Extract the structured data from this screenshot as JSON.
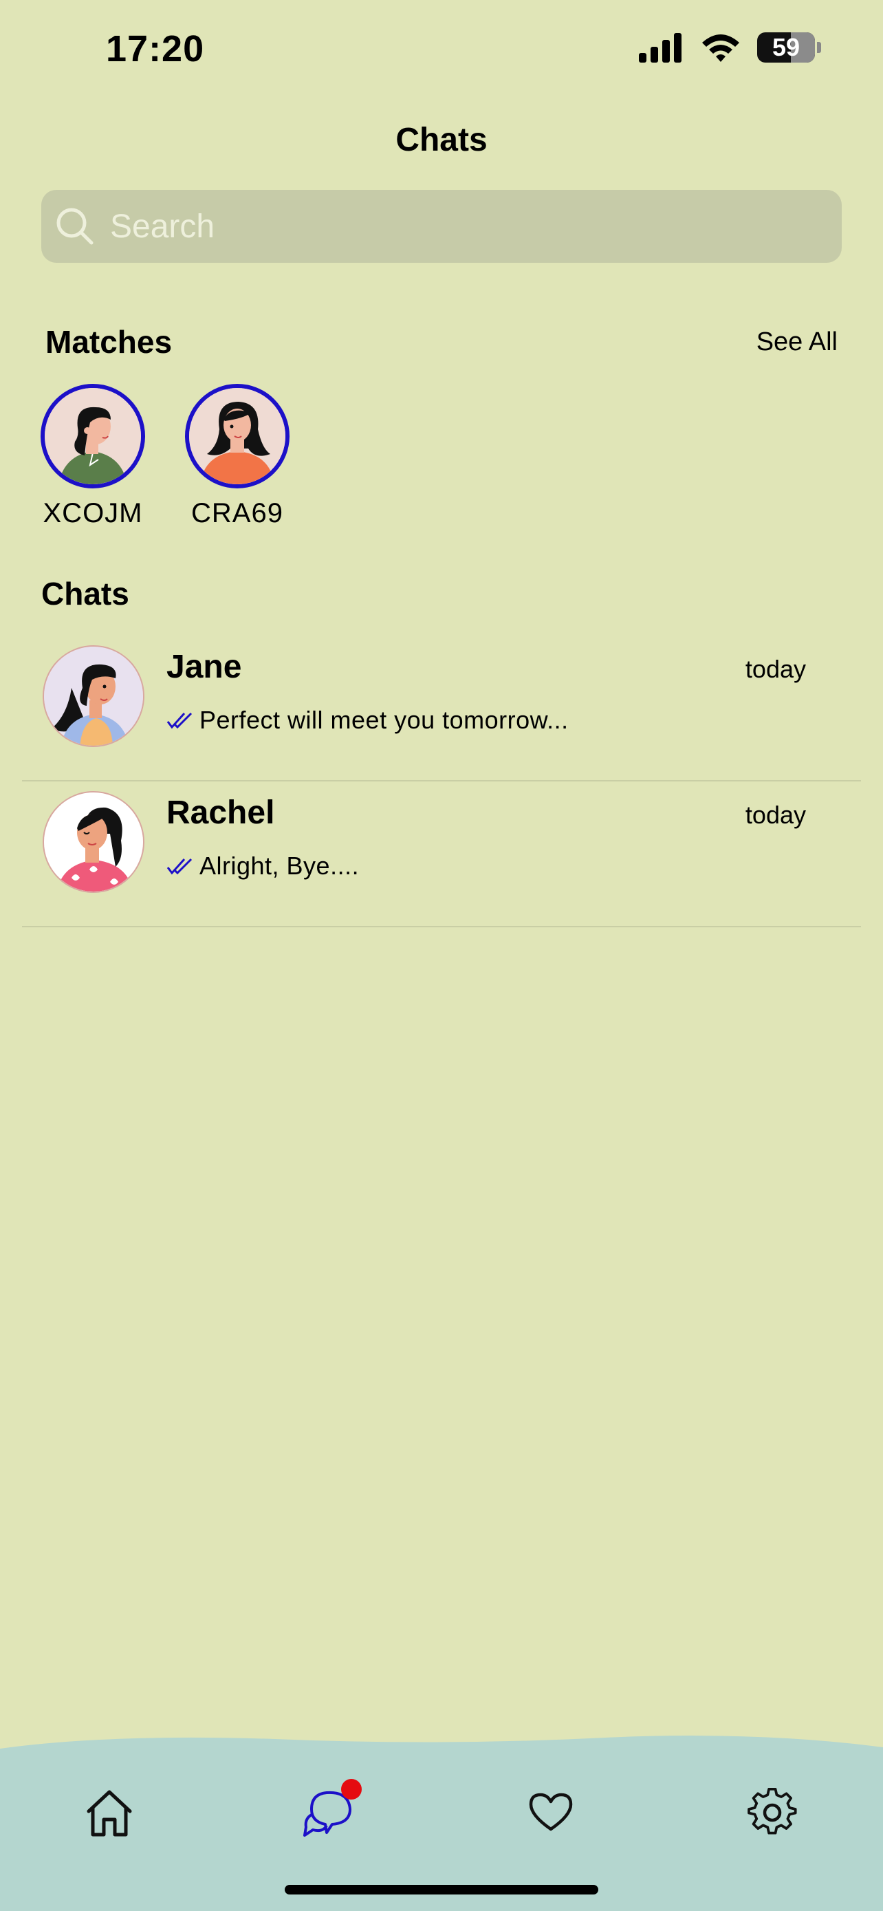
{
  "status_bar": {
    "time": "17:20",
    "battery": "59"
  },
  "header": {
    "title": "Chats"
  },
  "search": {
    "placeholder": "Search",
    "value": ""
  },
  "matches": {
    "title": "Matches",
    "see_all": "See All",
    "items": [
      {
        "name": "XCOJM"
      },
      {
        "name": "CRA69"
      }
    ]
  },
  "chats": {
    "title": "Chats",
    "items": [
      {
        "name": "Jane",
        "time": "today",
        "last_message": "Perfect will meet you tomorrow..."
      },
      {
        "name": "Rachel",
        "time": "today",
        "last_message": "Alright, Bye...."
      }
    ]
  },
  "tabbar": {
    "tabs": [
      {
        "icon": "home-icon"
      },
      {
        "icon": "chat-icon",
        "active": true,
        "badge": true
      },
      {
        "icon": "heart-icon"
      },
      {
        "icon": "gear-icon"
      }
    ]
  },
  "colors": {
    "background": "#e0e5b7",
    "tabbar": "#b4d6cf",
    "accent": "#1c10c8",
    "badge": "#e50b10"
  }
}
